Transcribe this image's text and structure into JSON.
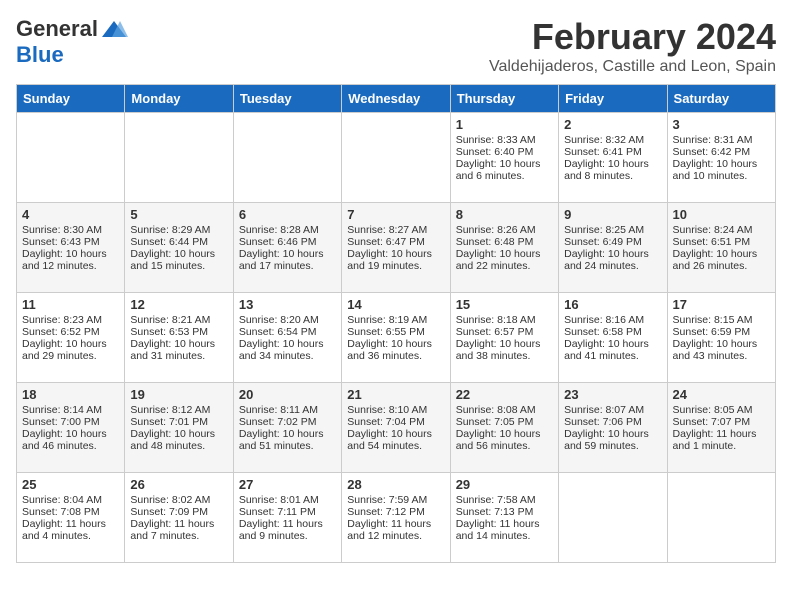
{
  "header": {
    "logo_general": "General",
    "logo_blue": "Blue",
    "month": "February 2024",
    "location": "Valdehijaderos, Castille and Leon, Spain"
  },
  "columns": [
    "Sunday",
    "Monday",
    "Tuesday",
    "Wednesday",
    "Thursday",
    "Friday",
    "Saturday"
  ],
  "weeks": [
    {
      "days": [
        {
          "num": "",
          "content": ""
        },
        {
          "num": "",
          "content": ""
        },
        {
          "num": "",
          "content": ""
        },
        {
          "num": "",
          "content": ""
        },
        {
          "num": "1",
          "content": "Sunrise: 8:33 AM\nSunset: 6:40 PM\nDaylight: 10 hours\nand 6 minutes."
        },
        {
          "num": "2",
          "content": "Sunrise: 8:32 AM\nSunset: 6:41 PM\nDaylight: 10 hours\nand 8 minutes."
        },
        {
          "num": "3",
          "content": "Sunrise: 8:31 AM\nSunset: 6:42 PM\nDaylight: 10 hours\nand 10 minutes."
        }
      ]
    },
    {
      "days": [
        {
          "num": "4",
          "content": "Sunrise: 8:30 AM\nSunset: 6:43 PM\nDaylight: 10 hours\nand 12 minutes."
        },
        {
          "num": "5",
          "content": "Sunrise: 8:29 AM\nSunset: 6:44 PM\nDaylight: 10 hours\nand 15 minutes."
        },
        {
          "num": "6",
          "content": "Sunrise: 8:28 AM\nSunset: 6:46 PM\nDaylight: 10 hours\nand 17 minutes."
        },
        {
          "num": "7",
          "content": "Sunrise: 8:27 AM\nSunset: 6:47 PM\nDaylight: 10 hours\nand 19 minutes."
        },
        {
          "num": "8",
          "content": "Sunrise: 8:26 AM\nSunset: 6:48 PM\nDaylight: 10 hours\nand 22 minutes."
        },
        {
          "num": "9",
          "content": "Sunrise: 8:25 AM\nSunset: 6:49 PM\nDaylight: 10 hours\nand 24 minutes."
        },
        {
          "num": "10",
          "content": "Sunrise: 8:24 AM\nSunset: 6:51 PM\nDaylight: 10 hours\nand 26 minutes."
        }
      ]
    },
    {
      "days": [
        {
          "num": "11",
          "content": "Sunrise: 8:23 AM\nSunset: 6:52 PM\nDaylight: 10 hours\nand 29 minutes."
        },
        {
          "num": "12",
          "content": "Sunrise: 8:21 AM\nSunset: 6:53 PM\nDaylight: 10 hours\nand 31 minutes."
        },
        {
          "num": "13",
          "content": "Sunrise: 8:20 AM\nSunset: 6:54 PM\nDaylight: 10 hours\nand 34 minutes."
        },
        {
          "num": "14",
          "content": "Sunrise: 8:19 AM\nSunset: 6:55 PM\nDaylight: 10 hours\nand 36 minutes."
        },
        {
          "num": "15",
          "content": "Sunrise: 8:18 AM\nSunset: 6:57 PM\nDaylight: 10 hours\nand 38 minutes."
        },
        {
          "num": "16",
          "content": "Sunrise: 8:16 AM\nSunset: 6:58 PM\nDaylight: 10 hours\nand 41 minutes."
        },
        {
          "num": "17",
          "content": "Sunrise: 8:15 AM\nSunset: 6:59 PM\nDaylight: 10 hours\nand 43 minutes."
        }
      ]
    },
    {
      "days": [
        {
          "num": "18",
          "content": "Sunrise: 8:14 AM\nSunset: 7:00 PM\nDaylight: 10 hours\nand 46 minutes."
        },
        {
          "num": "19",
          "content": "Sunrise: 8:12 AM\nSunset: 7:01 PM\nDaylight: 10 hours\nand 48 minutes."
        },
        {
          "num": "20",
          "content": "Sunrise: 8:11 AM\nSunset: 7:02 PM\nDaylight: 10 hours\nand 51 minutes."
        },
        {
          "num": "21",
          "content": "Sunrise: 8:10 AM\nSunset: 7:04 PM\nDaylight: 10 hours\nand 54 minutes."
        },
        {
          "num": "22",
          "content": "Sunrise: 8:08 AM\nSunset: 7:05 PM\nDaylight: 10 hours\nand 56 minutes."
        },
        {
          "num": "23",
          "content": "Sunrise: 8:07 AM\nSunset: 7:06 PM\nDaylight: 10 hours\nand 59 minutes."
        },
        {
          "num": "24",
          "content": "Sunrise: 8:05 AM\nSunset: 7:07 PM\nDaylight: 11 hours\nand 1 minute."
        }
      ]
    },
    {
      "days": [
        {
          "num": "25",
          "content": "Sunrise: 8:04 AM\nSunset: 7:08 PM\nDaylight: 11 hours\nand 4 minutes."
        },
        {
          "num": "26",
          "content": "Sunrise: 8:02 AM\nSunset: 7:09 PM\nDaylight: 11 hours\nand 7 minutes."
        },
        {
          "num": "27",
          "content": "Sunrise: 8:01 AM\nSunset: 7:11 PM\nDaylight: 11 hours\nand 9 minutes."
        },
        {
          "num": "28",
          "content": "Sunrise: 7:59 AM\nSunset: 7:12 PM\nDaylight: 11 hours\nand 12 minutes."
        },
        {
          "num": "29",
          "content": "Sunrise: 7:58 AM\nSunset: 7:13 PM\nDaylight: 11 hours\nand 14 minutes."
        },
        {
          "num": "",
          "content": ""
        },
        {
          "num": "",
          "content": ""
        }
      ]
    }
  ]
}
